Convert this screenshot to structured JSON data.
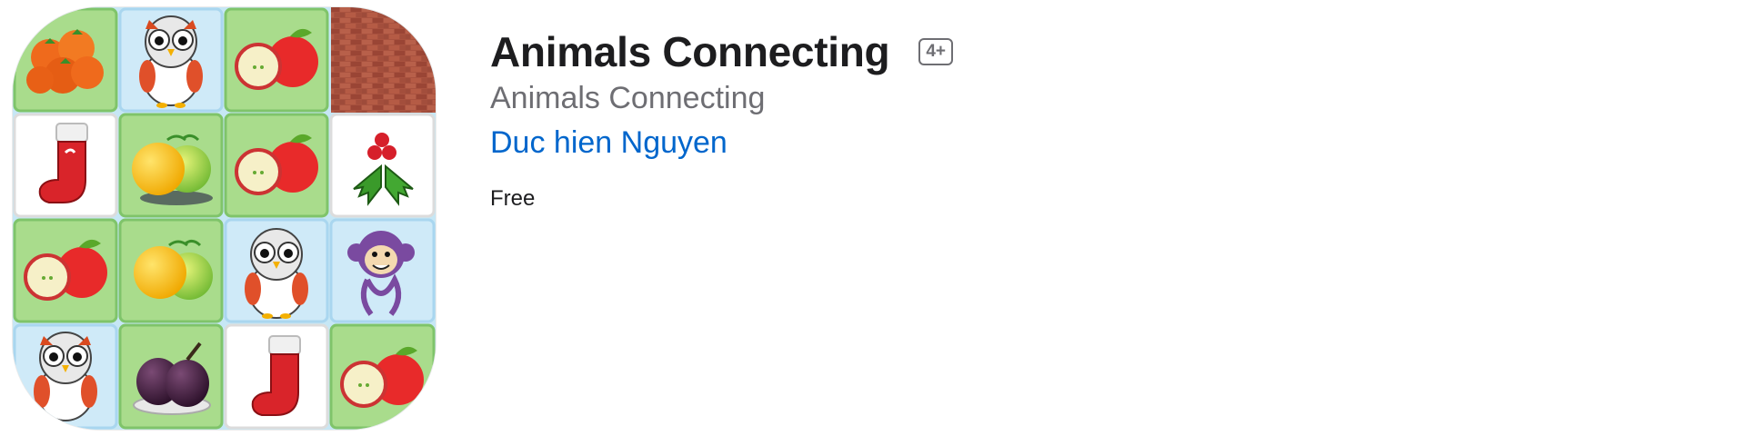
{
  "app": {
    "title": "Animals Connecting",
    "age_rating": "4+",
    "subtitle": "Animals Connecting",
    "developer": "Duc hien Nguyen",
    "price": "Free"
  },
  "icon": {
    "description_name": "app-icon",
    "tiles": [
      [
        "tomatoes",
        "owl",
        "apples",
        "brick-wall"
      ],
      [
        "stocking",
        "melons",
        "apples",
        "holly"
      ],
      [
        "apples",
        "melons",
        "owl",
        "monkey"
      ],
      [
        "owl",
        "plums",
        "stocking",
        "apples"
      ]
    ]
  },
  "colors": {
    "title": "#1d1d1f",
    "secondary": "#6e6e73",
    "link": "#0066cc",
    "tile_green": "#a9dc8c",
    "tile_blue": "#cfeaf8",
    "tile_white": "#ffffff"
  }
}
